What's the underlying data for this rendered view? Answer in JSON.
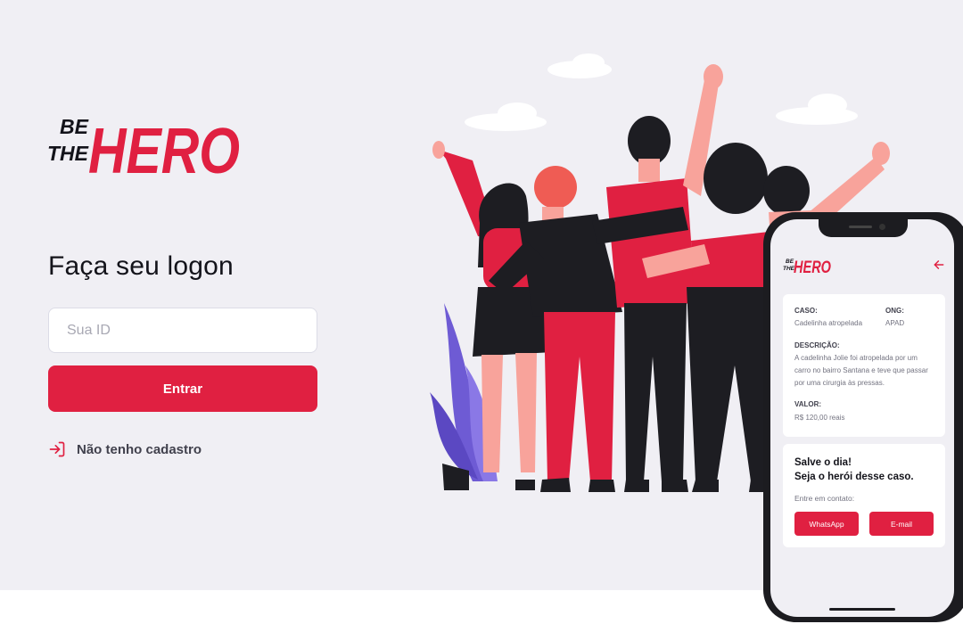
{
  "logo": {
    "line1": "BE",
    "line2": "THE",
    "line3": "HERO"
  },
  "login": {
    "title": "Faça seu logon",
    "id_placeholder": "Sua ID",
    "submit_label": "Entrar",
    "register_link": "Não tenho cadastro"
  },
  "phone": {
    "logo": {
      "line1": "BE",
      "line2": "THE",
      "line3": "HERO"
    },
    "case_label": "CASO:",
    "case_value": "Cadelinha atropelada",
    "ong_label": "ONG:",
    "ong_value": "APAD",
    "desc_label": "DESCRIÇÃO:",
    "desc_line1": "A cadelinha Jolie foi atropelada por um",
    "desc_line2": "carro no bairro Santana e teve que passar",
    "desc_line3": "por uma cirurgia às pressas.",
    "value_label": "VALOR:",
    "value": "R$ 120,00 reais",
    "cta_line1": "Salve o dia!",
    "cta_line2": "Seja o herói desse caso.",
    "contact_label": "Entre em contato:",
    "whatsapp_label": "WhatsApp",
    "email_label": "E-mail"
  },
  "colors": {
    "brand": "#e02041",
    "background": "#f0eff4",
    "text": "#13131a",
    "muted": "#737380"
  },
  "icons": {
    "register": "log-in-icon",
    "back": "arrow-left-icon"
  }
}
